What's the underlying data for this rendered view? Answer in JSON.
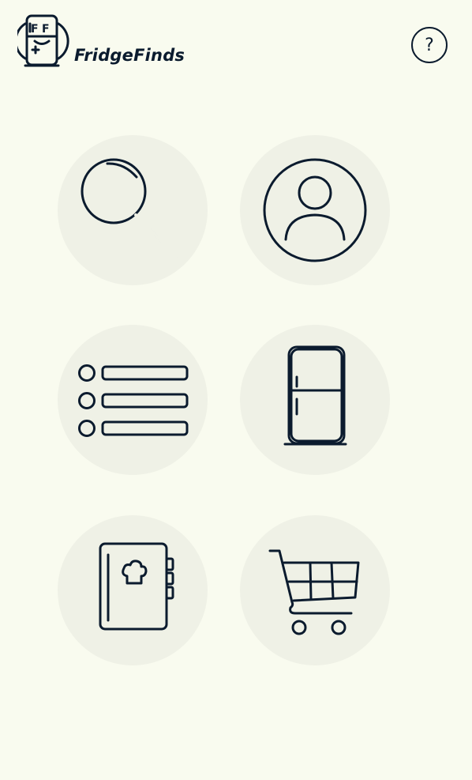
{
  "header": {
    "brand_name": "FridgeFinds",
    "help_label": "?",
    "logo_icon": "fridge-logo-icon"
  },
  "menu": {
    "tiles": [
      {
        "id": "search",
        "icon": "magnifier-icon"
      },
      {
        "id": "profile",
        "icon": "user-profile-icon"
      },
      {
        "id": "list",
        "icon": "list-icon"
      },
      {
        "id": "fridge",
        "icon": "fridge-icon"
      },
      {
        "id": "recipes",
        "icon": "recipe-book-icon"
      },
      {
        "id": "shopping",
        "icon": "shopping-cart-icon"
      }
    ]
  },
  "colors": {
    "background": "#f9fbef",
    "tile": "#eff1e6",
    "ink": "#0b1b2e"
  }
}
